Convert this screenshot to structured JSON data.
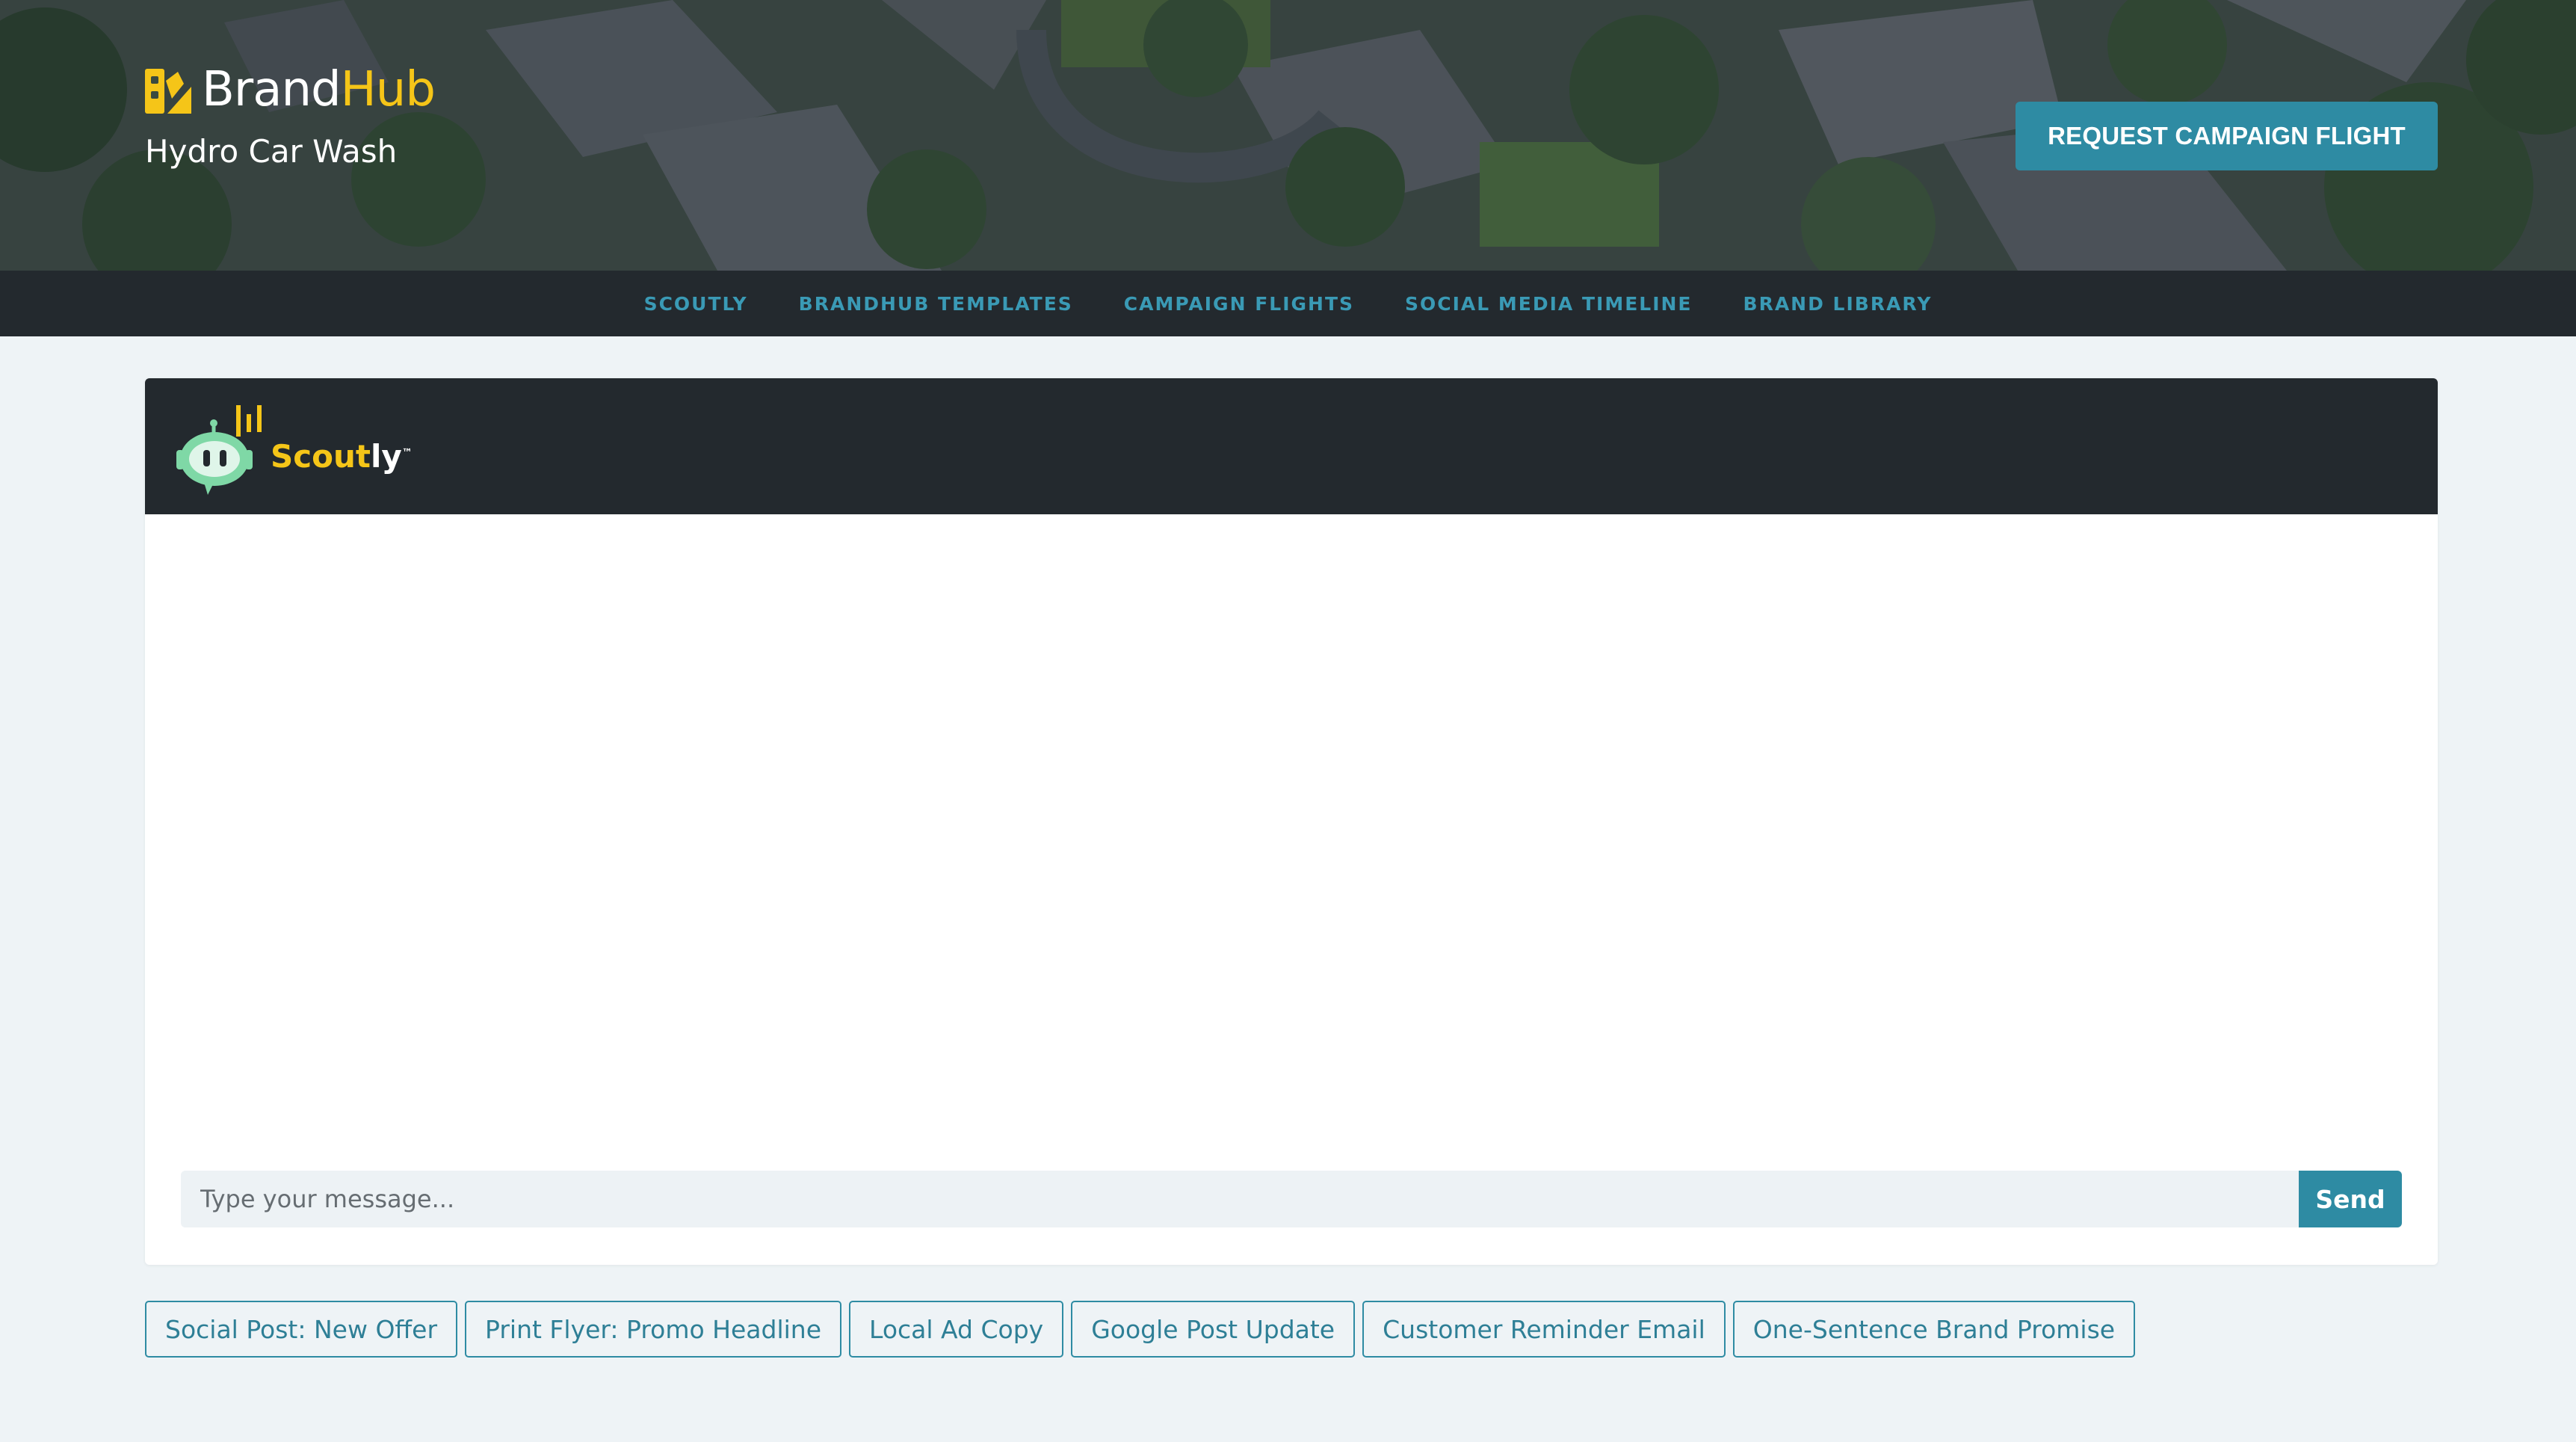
{
  "header": {
    "brand_part1": "Brand",
    "brand_part2": "Hub",
    "business_name": "Hydro Car Wash",
    "cta_label": "REQUEST CAMPAIGN FLIGHT"
  },
  "nav": {
    "items": [
      {
        "label": "SCOUTLY"
      },
      {
        "label": "BRANDHUB TEMPLATES"
      },
      {
        "label": "CAMPAIGN FLIGHTS"
      },
      {
        "label": "SOCIAL MEDIA TIMELINE"
      },
      {
        "label": "BRAND LIBRARY"
      }
    ]
  },
  "chat": {
    "assistant_name_part1": "Scout",
    "assistant_name_part2": "ly",
    "trademark": "™",
    "input_placeholder": "Type your message...",
    "send_label": "Send"
  },
  "prompts": [
    {
      "label": "Social Post: New Offer"
    },
    {
      "label": "Print Flyer: Promo Headline"
    },
    {
      "label": "Local Ad Copy"
    },
    {
      "label": "Google Post Update"
    },
    {
      "label": "Customer Reminder Email"
    },
    {
      "label": "One-Sentence Brand Promise"
    }
  ],
  "colors": {
    "accent": "#2e8ba3",
    "brand_yellow": "#f5c518",
    "dark": "#23292e",
    "page_bg": "#eef3f6"
  }
}
